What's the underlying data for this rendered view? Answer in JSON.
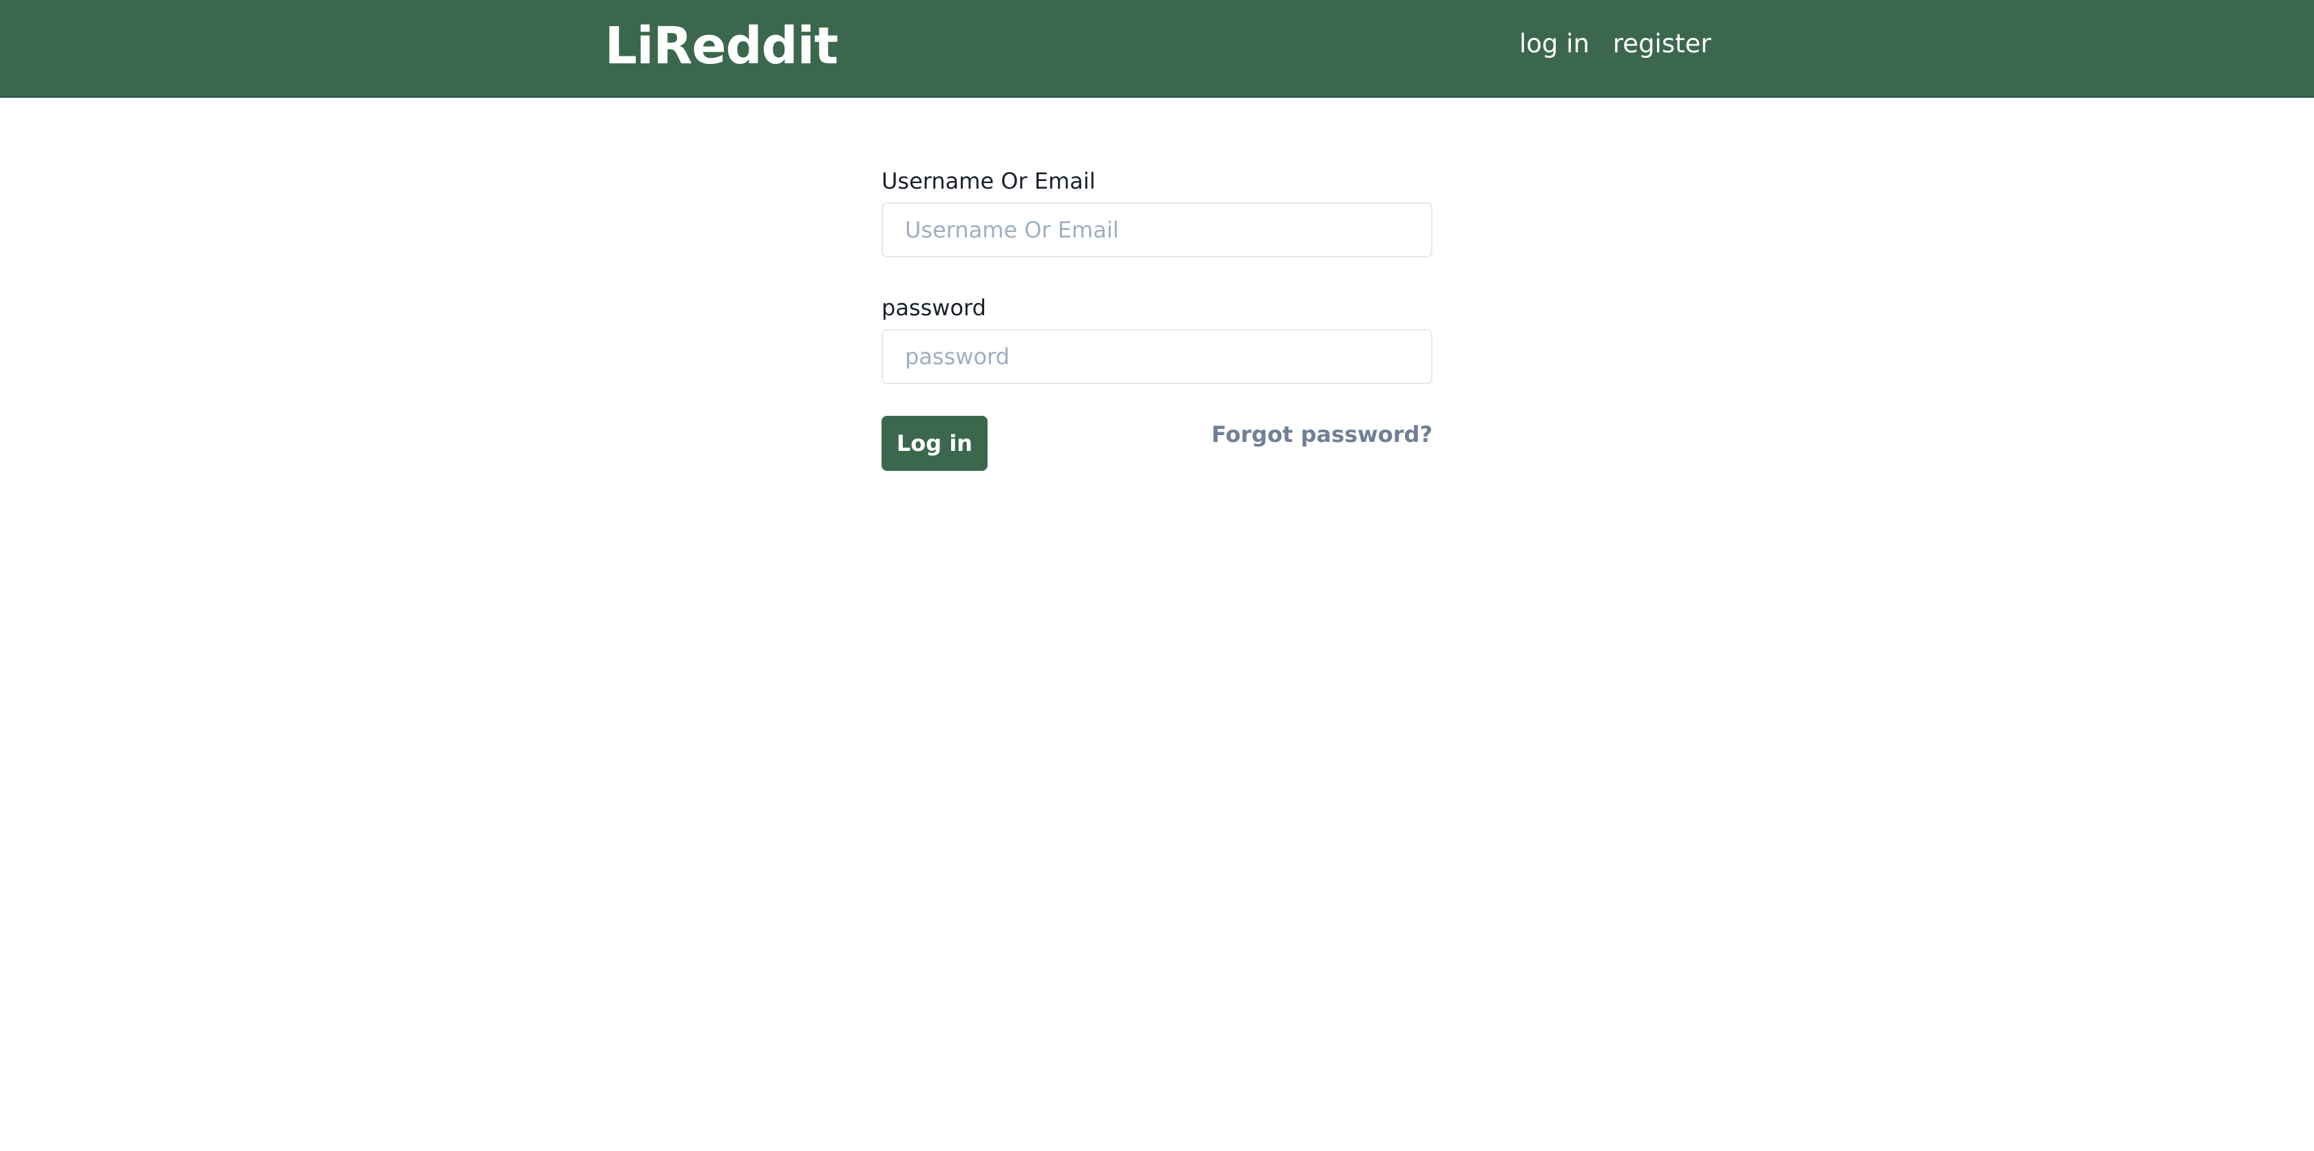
{
  "navbar": {
    "brand": "LiReddit",
    "links": {
      "login": "log in",
      "register": "register"
    }
  },
  "form": {
    "username": {
      "label": "Username Or Email",
      "placeholder": "Username Or Email",
      "value": ""
    },
    "password": {
      "label": "password",
      "placeholder": "password",
      "value": ""
    },
    "submit_label": "Log in",
    "forgot_label": "Forgot password?"
  },
  "colors": {
    "primary": "#3b684d",
    "muted_text": "#718096",
    "placeholder": "#a0aec0"
  }
}
